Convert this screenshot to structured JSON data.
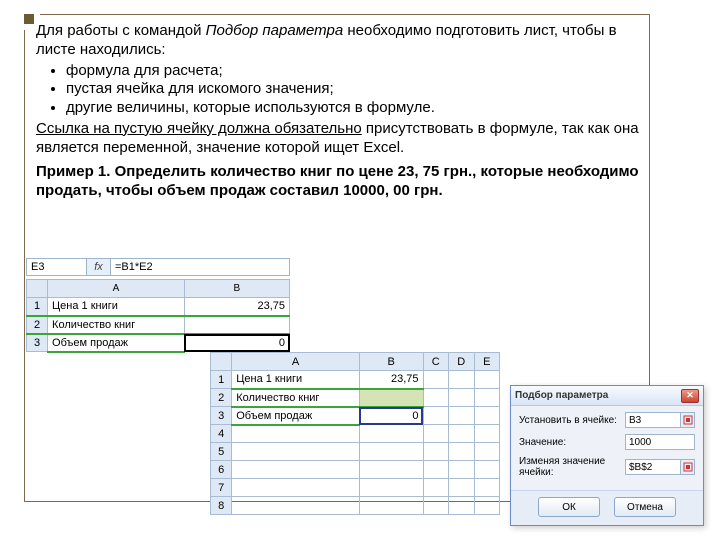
{
  "text": {
    "intro_before": "Для работы с командой ",
    "intro_italic": "Подбор параметра",
    "intro_after": " необходимо подготовить лист, чтобы в листе находились:",
    "b1": "формула для расчета;",
    "b2": "пустая ячейка для искомого значения;",
    "b3": "другие величины, которые используются в формуле.",
    "note_u": "Ссылка на пустую ячейку должна обязательно",
    "note_after": " присутствовать в формуле, так как она является переменной, значение которой ищет Excel.",
    "example": "Пример 1. Определить количество книг по цене 23, 75 грн., которые необходимо продать, чтобы объем продаж составил 10000, 00 грн."
  },
  "sheet1": {
    "namebox": "E3",
    "fx": "fx",
    "formula": "=B1*E2",
    "headers": {
      "a": "A",
      "b": "B"
    },
    "rows": [
      {
        "n": "1",
        "a": "Цена 1 книги",
        "b": "23,75"
      },
      {
        "n": "2",
        "a": "Количество книг",
        "b": ""
      },
      {
        "n": "3",
        "a": "Объем продаж",
        "b": "0"
      }
    ]
  },
  "sheet2": {
    "headers": {
      "a": "A",
      "b": "B",
      "c": "C",
      "d": "D",
      "e": "E"
    },
    "rows": [
      {
        "n": "1",
        "a": "Цена 1 книги",
        "b": "23,75"
      },
      {
        "n": "2",
        "a": "Количество книг",
        "b": ""
      },
      {
        "n": "3",
        "a": "Объем продаж",
        "b": "0"
      },
      {
        "n": "4",
        "a": "",
        "b": ""
      },
      {
        "n": "5",
        "a": "",
        "b": ""
      },
      {
        "n": "6",
        "a": "",
        "b": ""
      },
      {
        "n": "7",
        "a": "",
        "b": ""
      },
      {
        "n": "8",
        "a": "",
        "b": ""
      }
    ]
  },
  "dialog": {
    "title": "Подбор параметра",
    "close": "✕",
    "lbl1": "Установить в ячейке:",
    "val1": "B3",
    "lbl2": "Значение:",
    "val2": "1000",
    "lbl3": "Изменяя значение ячейки:",
    "val3": "$B$2",
    "ok": "ОК",
    "cancel": "Отмена"
  }
}
